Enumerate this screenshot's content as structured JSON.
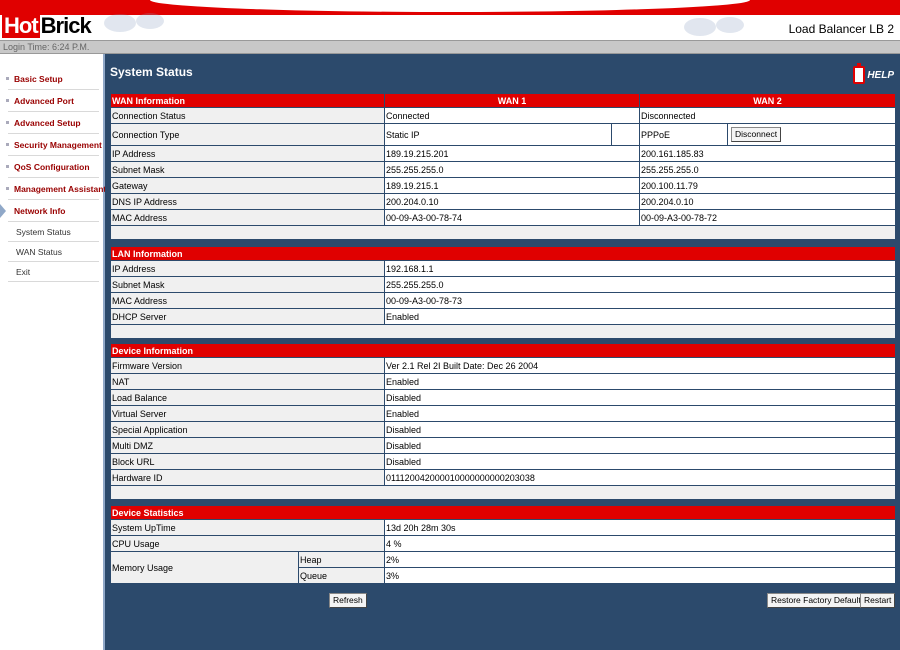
{
  "header": {
    "logo_hot": "Hot",
    "logo_brick": "Brick",
    "product": "Load Balancer LB 2",
    "login_time": "Login Time: 6:24 P.M."
  },
  "sidebar": {
    "items": [
      {
        "label": "Basic Setup"
      },
      {
        "label": "Advanced Port"
      },
      {
        "label": "Advanced Setup"
      },
      {
        "label": "Security Management"
      },
      {
        "label": "QoS Configuration"
      },
      {
        "label": "Management Assistant"
      },
      {
        "label": "Network Info"
      }
    ],
    "subitems": [
      {
        "label": "System Status"
      },
      {
        "label": "WAN Status"
      },
      {
        "label": "Exit"
      }
    ]
  },
  "main": {
    "title": "System Status",
    "help": "HELP",
    "wan": {
      "header": "WAN Information",
      "col1": "WAN 1",
      "col2": "WAN 2",
      "rows": [
        {
          "label": "Connection Status",
          "wan1": "Connected",
          "wan2": "Disconnected"
        },
        {
          "label": "Connection Type",
          "wan1": "Static IP",
          "wan2": "PPPoE"
        },
        {
          "label": "IP Address",
          "wan1": "189.19.215.201",
          "wan2": "200.161.185.83"
        },
        {
          "label": "Subnet Mask",
          "wan1": "255.255.255.0",
          "wan2": "255.255.255.0"
        },
        {
          "label": "Gateway",
          "wan1": "189.19.215.1",
          "wan2": "200.100.11.79"
        },
        {
          "label": "DNS IP Address",
          "wan1": "200.204.0.10",
          "wan2": "200.204.0.10"
        },
        {
          "label": "MAC Address",
          "wan1": "00-09-A3-00-78-74",
          "wan2": "00-09-A3-00-78-72"
        }
      ],
      "disconnect": "Disconnect"
    },
    "lan": {
      "header": "LAN Information",
      "rows": [
        {
          "label": "IP Address",
          "value": "192.168.1.1"
        },
        {
          "label": "Subnet Mask",
          "value": "255.255.255.0"
        },
        {
          "label": "MAC Address",
          "value": "00-09-A3-00-78-73"
        },
        {
          "label": "DHCP Server",
          "value": "Enabled"
        }
      ]
    },
    "device": {
      "header": "Device Information",
      "rows": [
        {
          "label": "Firmware Version",
          "value": "Ver 2.1 Rel 2I Built Date: Dec 26 2004"
        },
        {
          "label": "NAT",
          "value": "Enabled"
        },
        {
          "label": "Load Balance",
          "value": "Disabled"
        },
        {
          "label": "Virtual Server",
          "value": "Enabled"
        },
        {
          "label": "Special Application",
          "value": "Disabled"
        },
        {
          "label": "Multi DMZ",
          "value": "Disabled"
        },
        {
          "label": "Block URL",
          "value": "Disabled"
        },
        {
          "label": "Hardware ID",
          "value": "011120042000010000000000203038"
        }
      ]
    },
    "stats": {
      "header": "Device Statistics",
      "uptime_label": "System UpTime",
      "uptime": "13d 20h 28m 30s",
      "cpu_label": "CPU Usage",
      "cpu": "4 %",
      "memory_label": "Memory Usage",
      "heap_label": "Heap",
      "heap": "2%",
      "queue_label": "Queue",
      "queue": "3%"
    },
    "buttons": {
      "refresh": "Refresh",
      "restore": "Restore Factory Defaults",
      "restart": "Restart"
    }
  }
}
